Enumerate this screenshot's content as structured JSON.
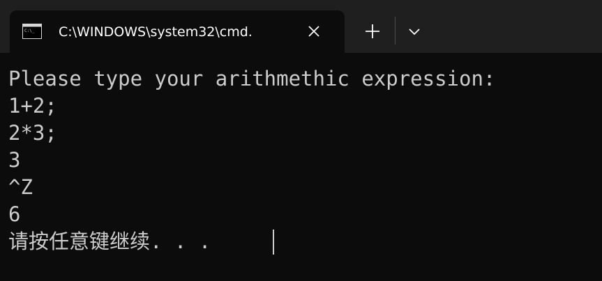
{
  "tab": {
    "title": "C:\\WINDOWS\\system32\\cmd.",
    "icon": "command-prompt-icon",
    "close_icon": "close-icon"
  },
  "tabbar": {
    "new_tab_icon": "plus-icon",
    "dropdown_icon": "chevron-down-icon"
  },
  "colors": {
    "terminal_background": "#0c0c0c",
    "terminal_text": "#cccccc",
    "tabbar_background": "#1f1f1f",
    "tab_title": "#ffffff"
  },
  "console": {
    "lines": [
      "Please type your arithmethic expression:",
      "1+2;",
      "2*3;",
      "3",
      "^Z",
      "6",
      "请按任意键继续. . ."
    ]
  }
}
